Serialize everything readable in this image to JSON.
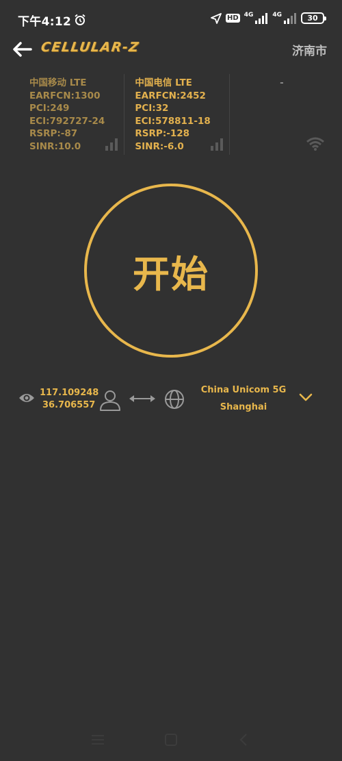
{
  "status_bar": {
    "time": "下午4:12",
    "hd": "HD",
    "net1": "4G",
    "net2": "4G",
    "battery": "30"
  },
  "header": {
    "logo_text": "CELLULAR-Z",
    "city": "济南市"
  },
  "cells": [
    {
      "carrier": "中国移动 LTE",
      "earfcn": "EARFCN:1300",
      "pci": "PCI:249",
      "eci": "ECI:792727-24",
      "rsrp": "RSRP:-87",
      "sinr": "SINR:10.0"
    },
    {
      "carrier": "中国电信 LTE",
      "earfcn": "EARFCN:2452",
      "pci": "PCI:32",
      "eci": "ECI:578811-18",
      "rsrp": "RSRP:-128",
      "sinr": "SINR:-6.0"
    },
    {
      "carrier": "-"
    }
  ],
  "start_button": {
    "label": "开始"
  },
  "location": {
    "longitude": "117.109248",
    "latitude": "36.706557"
  },
  "server": {
    "name": "China Unicom 5G",
    "city": "Shanghai"
  },
  "colors": {
    "accent": "#e8b74c",
    "background": "#313131",
    "dim_accent": "#a88a4a"
  }
}
